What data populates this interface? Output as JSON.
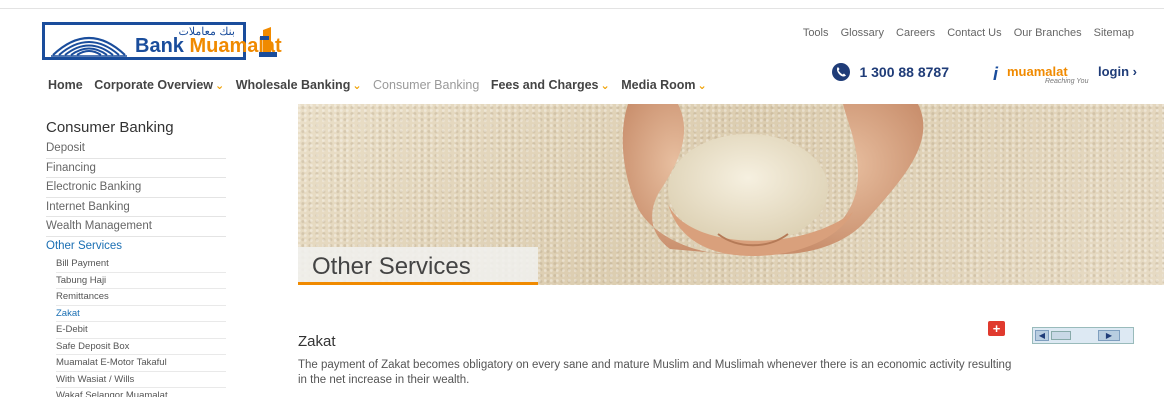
{
  "logo": {
    "arabic": "بنك معاملات",
    "bank": "Bank",
    "muamalat": "Muamalat"
  },
  "top_links": [
    "Tools",
    "Glossary",
    "Careers",
    "Contact Us",
    "Our Branches",
    "Sitemap"
  ],
  "main_nav": [
    {
      "label": "Home",
      "dropdown": false,
      "active": false
    },
    {
      "label": "Corporate Overview",
      "dropdown": true,
      "active": false
    },
    {
      "label": "Wholesale Banking",
      "dropdown": true,
      "active": false
    },
    {
      "label": "Consumer Banking",
      "dropdown": false,
      "active": true
    },
    {
      "label": "Fees and Charges",
      "dropdown": true,
      "active": false
    },
    {
      "label": "Media Room",
      "dropdown": true,
      "active": false
    }
  ],
  "contact": {
    "phone": "1 300 88 8787",
    "imuamalat": "muamalat",
    "imuamalat_tagline": "Reaching You",
    "login": "login"
  },
  "sidebar": {
    "title": "Consumer Banking",
    "items": [
      {
        "label": "Deposit"
      },
      {
        "label": "Financing"
      },
      {
        "label": "Electronic Banking"
      },
      {
        "label": "Internet Banking"
      },
      {
        "label": "Wealth Management"
      },
      {
        "label": "Other Services",
        "active": true
      }
    ],
    "sub_items": [
      {
        "label": "Bill Payment"
      },
      {
        "label": "Tabung Haji"
      },
      {
        "label": "Remittances"
      },
      {
        "label": "Zakat",
        "active": true
      },
      {
        "label": "E-Debit"
      },
      {
        "label": "Safe Deposit Box"
      },
      {
        "label": "Muamalat E-Motor Takaful"
      },
      {
        "label": "With Wasiat / Wills"
      },
      {
        "label": "Wakaf Selangor Muamalat"
      }
    ]
  },
  "banner": {
    "caption": "Other Services"
  },
  "content": {
    "title": "Zakat",
    "body": "The payment of Zakat becomes obligatory on every sane and mature Muslim and Muslimah whenever there is an economic activity resulting in the net increase in their wealth."
  },
  "colors": {
    "brand_blue": "#1a4d9c",
    "brand_orange": "#f08a00",
    "active_link": "#1a6fb3",
    "plus_red": "#e03a2e"
  }
}
